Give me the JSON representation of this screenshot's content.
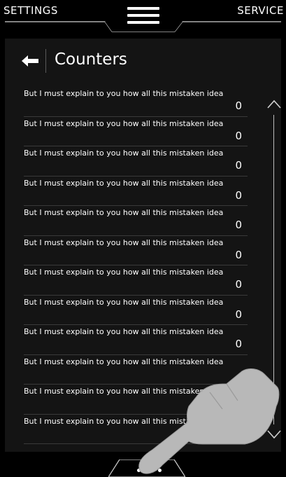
{
  "top": {
    "left_tab": "SETTINGS",
    "right_tab": "SERVICE"
  },
  "header": {
    "title": "Counters"
  },
  "counters": [
    {
      "label": "But I must explain to you how all this mistaken idea",
      "value": "0"
    },
    {
      "label": "But I must explain to you how all this mistaken idea",
      "value": "0"
    },
    {
      "label": "But I must explain to you how all this mistaken idea",
      "value": "0"
    },
    {
      "label": "But I must explain to you how all this mistaken idea",
      "value": "0"
    },
    {
      "label": "But I must explain to you how all this mistaken idea",
      "value": "0"
    },
    {
      "label": "But I must explain to you how all this mistaken idea",
      "value": "0"
    },
    {
      "label": "But I must explain to you how all this mistaken idea",
      "value": "0"
    },
    {
      "label": "But I must explain to you how all this mistaken idea",
      "value": "0"
    },
    {
      "label": "But I must explain to you how all this mistaken idea",
      "value": "0"
    },
    {
      "label": "But I must explain to you how all this mistaken idea",
      "value": ""
    },
    {
      "label": "But I must explain to you how all this mistaken idea",
      "value": ""
    },
    {
      "label": "But I must explain to you how all this mistaken idea",
      "value": ""
    }
  ],
  "pager": {
    "total": 2,
    "current": 1
  },
  "icons": {
    "back": "arrow-left-icon",
    "menu": "hamburger-menu-icon",
    "scroll_up": "chevron-up-icon",
    "scroll_down": "chevron-down-icon",
    "hand": "pointing-hand-icon"
  },
  "colors": {
    "background": "#000000",
    "panel": "#141414",
    "text": "#ffffff",
    "divider": "#3a3a3a",
    "hand": "#b8b8b8"
  }
}
